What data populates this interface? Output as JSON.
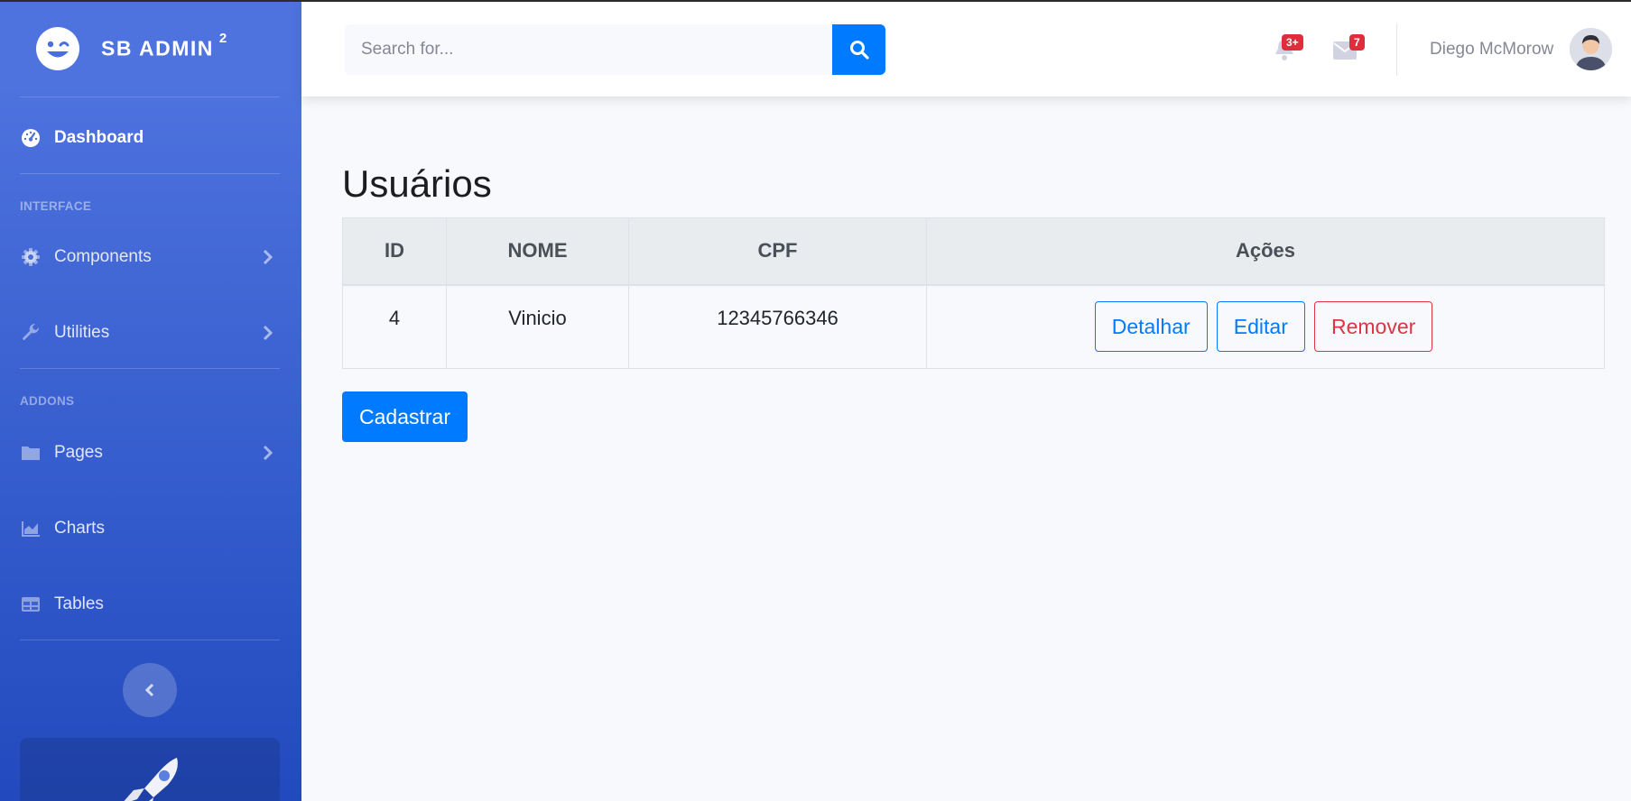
{
  "sidebar": {
    "brand": {
      "name": "SB ADMIN",
      "sup": "2"
    },
    "dashboard": "Dashboard",
    "heading_interface": "INTERFACE",
    "components": "Components",
    "utilities": "Utilities",
    "heading_addons": "ADDONS",
    "pages": "Pages",
    "charts": "Charts",
    "tables": "Tables"
  },
  "topbar": {
    "search_placeholder": "Search for...",
    "alerts_count": "3+",
    "messages_count": "7",
    "user_name": "Diego McMorow"
  },
  "main": {
    "title": "Usuários",
    "table": {
      "headers": [
        "ID",
        "NOME",
        "CPF",
        "Ações"
      ],
      "rows": [
        {
          "id": "4",
          "nome": "Vinicio",
          "cpf": "12345766346"
        }
      ],
      "actions": {
        "detail": "Detalhar",
        "edit": "Editar",
        "remove": "Remover"
      }
    },
    "create_button": "Cadastrar"
  },
  "colors": {
    "sidebar_gradient_start": "#4e73df",
    "sidebar_gradient_end": "#224abe",
    "primary": "#007bff",
    "danger": "#dc3545",
    "badge": "#e02d3c"
  }
}
